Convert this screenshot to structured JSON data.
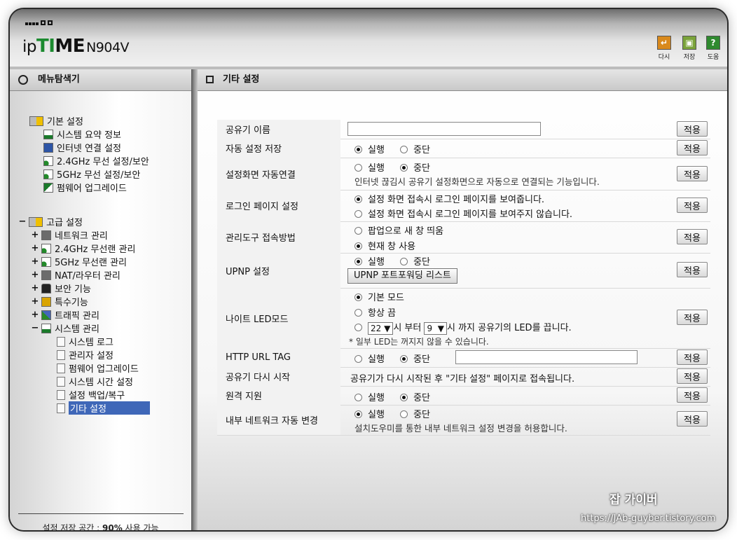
{
  "header": {
    "logo_ip": "ip",
    "logo_time_t": "TI",
    "logo_time_rest": "ME",
    "model": "N904V",
    "buttons": [
      {
        "label": "다시",
        "icon": "reload-icon",
        "color": "#d9891c"
      },
      {
        "label": "저장",
        "icon": "save-icon",
        "color": "#7aa33a"
      },
      {
        "label": "도움",
        "icon": "help-icon",
        "color": "#2f8a2f",
        "glyph": "?"
      }
    ]
  },
  "sidebar": {
    "title": "메뉴탐색기",
    "basic": {
      "label": "기본 설정",
      "items": [
        "시스템 요약 정보",
        "인터넷 연결 설정",
        "2.4GHz 무선 설정/보안",
        "5GHz 무선 설정/보안",
        "펌웨어 업그레이드"
      ]
    },
    "advanced": {
      "expander": "−",
      "label": "고급 설정",
      "items": [
        {
          "label": "네트워크 관리",
          "expander": "+"
        },
        {
          "label": "2.4GHz 무선랜 관리",
          "expander": "+"
        },
        {
          "label": "5GHz 무선랜 관리",
          "expander": "+"
        },
        {
          "label": "NAT/라우터 관리",
          "expander": "+"
        },
        {
          "label": "보안 기능",
          "expander": "+"
        },
        {
          "label": "특수기능",
          "expander": "+"
        },
        {
          "label": "트래픽 관리",
          "expander": "+"
        },
        {
          "label": "시스템 관리",
          "expander": "−"
        }
      ],
      "system_items": [
        "시스템 로그",
        "관리자 설정",
        "펌웨어 업그레이드",
        "시스템 시간 설정",
        "설정 백업/복구",
        "기타 설정"
      ]
    },
    "footer_prefix": "설정 저장 공간 : ",
    "footer_value": "90%",
    "footer_suffix": " 사용 가능"
  },
  "main": {
    "title": "기타 설정",
    "apply_label": "적용",
    "run": "실행",
    "stop": "중단",
    "rows": {
      "router_name": {
        "label": "공유기 이름",
        "value": ""
      },
      "auto_save": {
        "label": "자동 설정 저장",
        "selected": "실행"
      },
      "auto_connect": {
        "label": "설정화면 자동연결",
        "selected": "중단",
        "note": "인터넷 끊김시 공유기 설정화면으로 자동으로 연결되는 기능입니다."
      },
      "login_page": {
        "label": "로그인 페이지 설정",
        "opt1": "설정 화면 접속시 로그인 페이지를 보여줍니다.",
        "opt2": "설정 화면 접속시 로그인 페이지를 보여주지 않습니다.",
        "selected": 1
      },
      "admin_tool": {
        "label": "관리도구 접속방법",
        "opt1": "팝업으로 새 창 띄움",
        "opt2": "현재 창 사용",
        "selected": 2
      },
      "upnp": {
        "label": "UPNP 설정",
        "selected": "실행",
        "list_button": "UPNP 포트포워딩 리스트"
      },
      "night_led": {
        "label": "나이트 LED모드",
        "opt1": "기본 모드",
        "opt2": "항상 끔",
        "from_value": "22",
        "from_text": "시 부터",
        "to_value": "9",
        "to_text": "시 까지 공유기의 LED를 끕니다.",
        "selected": 1,
        "note": "* 일부 LED는 꺼지지 않을 수 있습니다."
      },
      "http_url_tag": {
        "label": "HTTP URL TAG",
        "selected": "중단",
        "value": ""
      },
      "restart": {
        "label": "공유기 다시 시작",
        "text": "공유기가 다시 시작된 후 \"기타 설정\" 페이지로 접속됩니다."
      },
      "remote": {
        "label": "원격 지원",
        "selected": "중단"
      },
      "internal_net": {
        "label": "내부 네트워크 자동 변경",
        "selected": "실행",
        "note": "설치도우미를 통한 내부 네트워크 설정 변경을 허용합니다."
      }
    }
  },
  "watermark": {
    "title": "잡 가이버",
    "url": "https://JAb-guyber.tistory.com"
  }
}
